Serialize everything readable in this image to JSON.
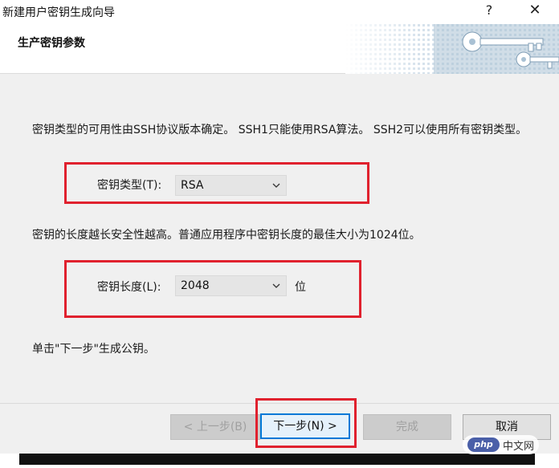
{
  "window": {
    "title": "新建用户密钥生成向导",
    "help_glyph": "?",
    "close_glyph": "✕"
  },
  "header": {
    "heading": "生产密钥参数",
    "art_icon": "keys-banner-icon"
  },
  "main": {
    "key_type_description": "密钥类型的可用性由SSH协议版本确定。 SSH1只能使用RSA算法。 SSH2可以使用所有密钥类型。",
    "key_type_label": "密钥类型(T):",
    "key_type_value": "RSA",
    "key_length_description": "密钥的长度越长安全性越高。普通应用程序中密钥长度的最佳大小为1024位。",
    "key_length_label": "密钥长度(L):",
    "key_length_value": "2048",
    "key_length_unit": "位",
    "instruction": "单击\"下一步\"生成公钥。"
  },
  "footer": {
    "back_label": "< 上一步(B)",
    "next_label": "下一步(N) >",
    "finish_label": "完成",
    "cancel_label": "取消"
  },
  "watermark": {
    "logo_text": "php",
    "site_text": "中文网"
  },
  "colors": {
    "highlight": "#e0212e",
    "primary_border": "#0078d7",
    "dialog_bg": "#f0f0f0"
  }
}
